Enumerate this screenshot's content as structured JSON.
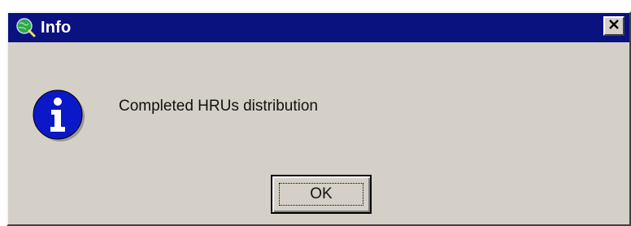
{
  "window": {
    "title": "Info",
    "title_icon": "globe-magnifier-icon",
    "close_icon": "close-icon",
    "titlebar_color": "#0a1280",
    "body_color": "#d4d0c8"
  },
  "dialog": {
    "icon": "info-icon",
    "icon_color": "#0b18c8",
    "message": "Completed HRUs distribution",
    "ok_label": "OK"
  }
}
